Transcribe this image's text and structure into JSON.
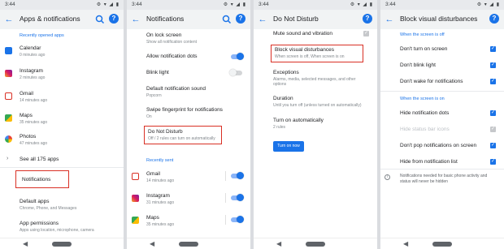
{
  "status": {
    "time": "3:44",
    "icons": "⚙ ▾ ◢ ▮"
  },
  "colors": {
    "accent": "#1a73e8",
    "highlight": "#d93025"
  },
  "p1": {
    "title": "Apps & notifications",
    "recent_header": "Recently opened apps",
    "apps": [
      {
        "name": "Calendar",
        "sub": "0 minutes ago"
      },
      {
        "name": "Instagram",
        "sub": "2 minutes ago"
      },
      {
        "name": "Gmail",
        "sub": "14 minutes ago"
      },
      {
        "name": "Maps",
        "sub": "35 minutes ago"
      },
      {
        "name": "Photos",
        "sub": "47 minutes ago"
      }
    ],
    "see_all": "See all 175 apps",
    "notifications": "Notifications",
    "default_apps": {
      "title": "Default apps",
      "sub": "Chrome, Phone, and Messages"
    },
    "app_permissions": {
      "title": "App permissions",
      "sub": "Apps using location, microphone, camera"
    }
  },
  "p2": {
    "title": "Notifications",
    "on_lock": {
      "title": "On lock screen",
      "sub": "Show all notification content"
    },
    "allow_dots": "Allow notification dots",
    "blink": "Blink light",
    "default_sound": {
      "title": "Default notification sound",
      "sub": "Popcorn"
    },
    "swipe": {
      "title": "Swipe fingerprint for notifications",
      "sub": "On"
    },
    "dnd": {
      "title": "Do Not Disturb",
      "sub": "Off / 2 rules can turn on automatically"
    },
    "recent_header": "Recently sent",
    "apps": [
      {
        "name": "Gmail",
        "sub": "14 minutes ago"
      },
      {
        "name": "Instagram",
        "sub": "31 minutes ago"
      },
      {
        "name": "Maps",
        "sub": "35 minutes ago"
      }
    ]
  },
  "p3": {
    "title": "Do Not Disturb",
    "mute": "Mute sound and vibration",
    "block": {
      "title": "Block visual disturbances",
      "sub": "When screen is off, When screen is on"
    },
    "exceptions": {
      "title": "Exceptions",
      "sub": "Alarms, media, selected messages, and other options"
    },
    "duration": {
      "title": "Duration",
      "sub": "Until you turn off (unless turned on automatically)"
    },
    "turn_on_auto": {
      "title": "Turn on automatically",
      "sub": "2 rules"
    },
    "turn_on_now": "Turn on now"
  },
  "p4": {
    "title": "Block visual disturbances",
    "off_header": "When the screen is off",
    "off_items": [
      "Don't turn on screen",
      "Don't blink light",
      "Don't wake for notifications"
    ],
    "on_header": "When the screen is on",
    "on_items": [
      "Hide notification dots",
      "Hide status bar icons",
      "Don't pop notifications on screen",
      "Hide from notification list"
    ],
    "footer": [
      "Notifications needed for basic phone activity and",
      "status will never be hidden"
    ]
  }
}
